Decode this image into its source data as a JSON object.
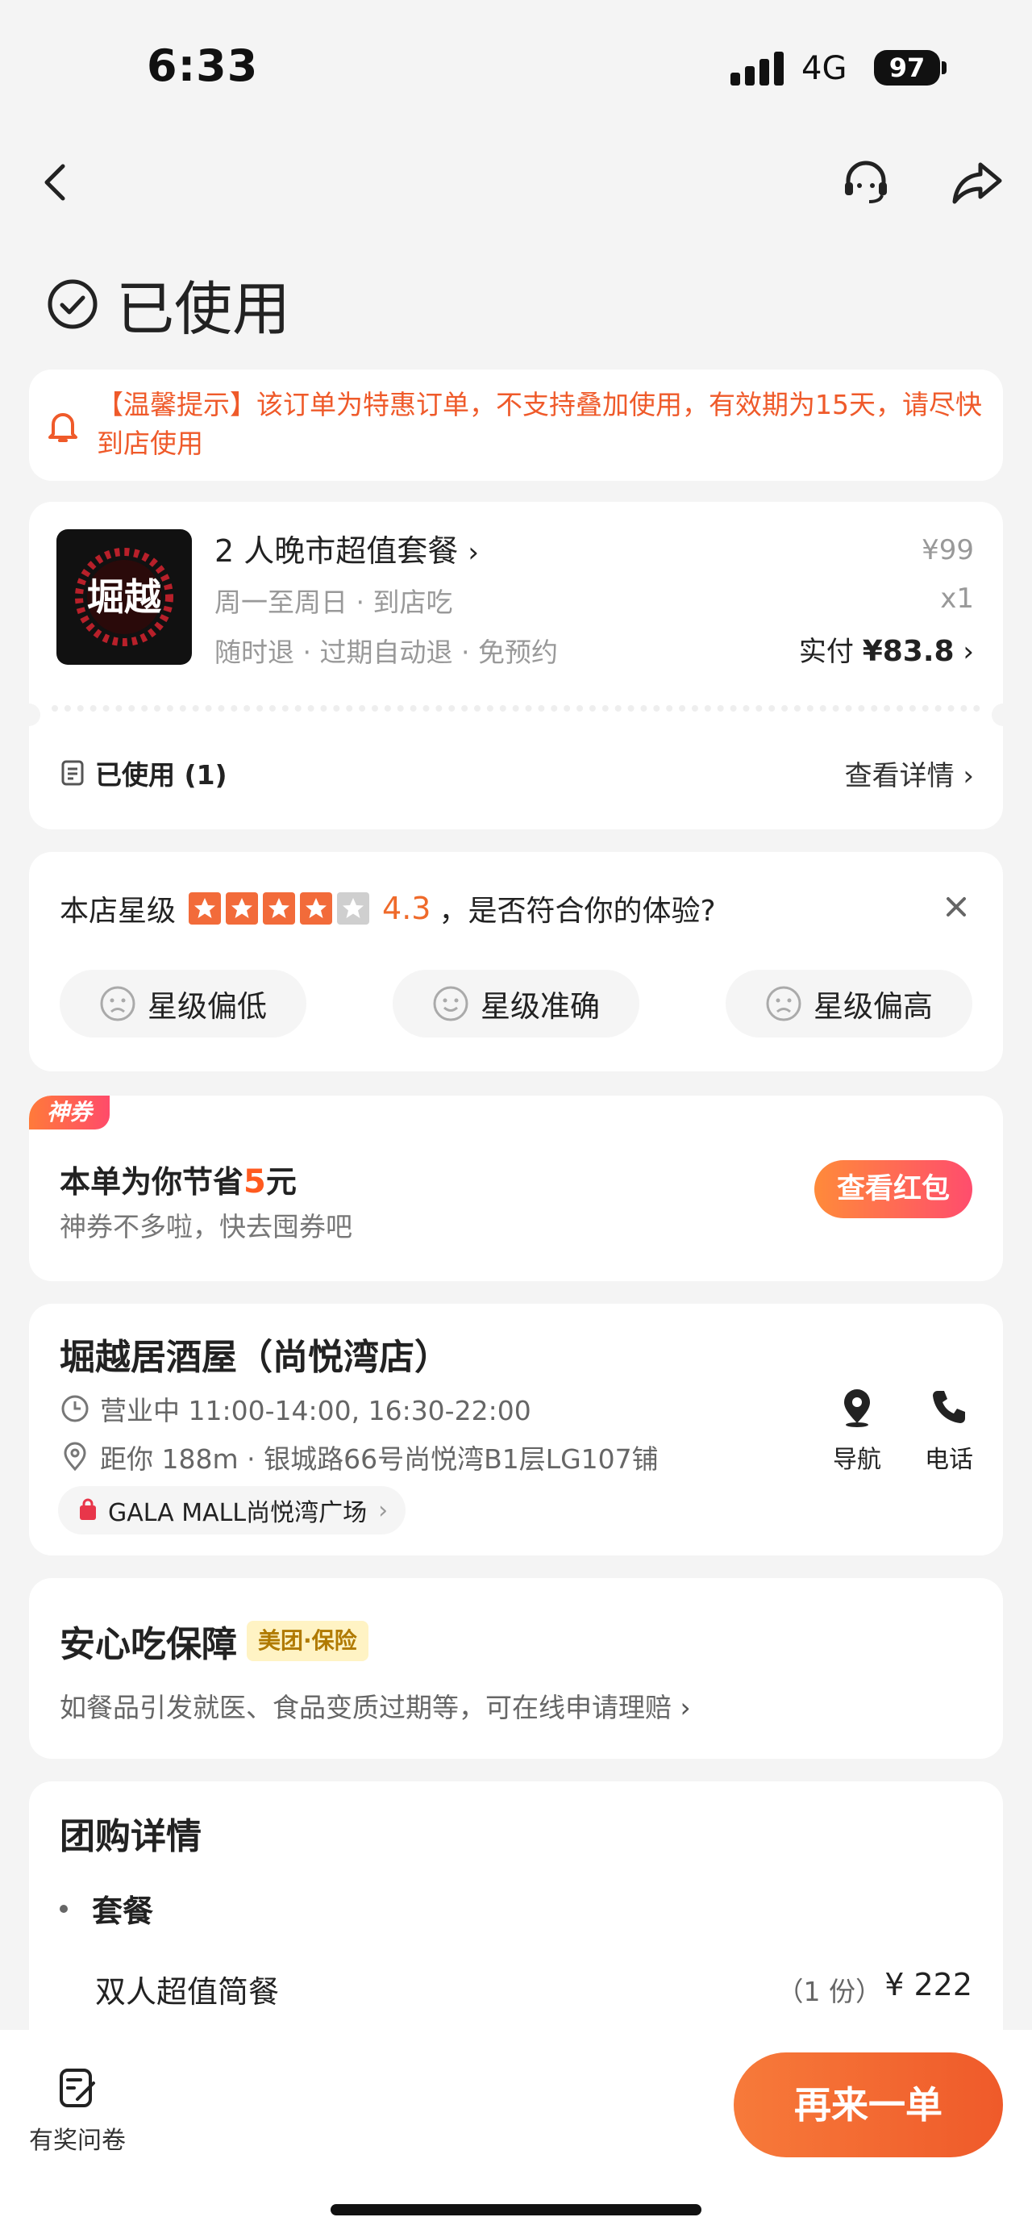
{
  "status_bar": {
    "time": "6:33",
    "network": "4G",
    "battery": "97"
  },
  "page": {
    "status_title": "已使用"
  },
  "notice": {
    "text": "【温馨提示】该订单为特惠订单，不支持叠加使用，有效期为15天，请尽快到店使用"
  },
  "order": {
    "title": "2 人晚市超值套餐",
    "subtitle": "周一至周日 · 到店吃",
    "tags": "随时退 · 过期自动退 · 免预约",
    "price": "¥99",
    "quantity": "x1",
    "paid_label": "实付",
    "paid_amount": "¥83.8",
    "used_label": "已使用 (1)",
    "detail_link": "查看详情",
    "logo_text": "堀越"
  },
  "rating": {
    "label": "本店星级",
    "score": "4.3",
    "question": "，是否符合你的体验?",
    "stars_filled": 4,
    "stars_total": 5,
    "options": [
      "星级偏低",
      "星级准确",
      "星级偏高"
    ]
  },
  "coupon": {
    "badge": "神券",
    "title_prefix": "本单为你节省",
    "amount": "5",
    "title_suffix": "元",
    "subtitle": "神券不多啦，快去囤券吧",
    "button": "查看红包"
  },
  "shop": {
    "name": "堀越居酒屋（尚悦湾店）",
    "hours": "营业中 11:00-14:00, 16:30-22:00",
    "distance": "距你 188m ·  银城路66号尚悦湾B1层LG107铺",
    "mall": "GALA MALL尚悦湾广场",
    "nav_label": "导航",
    "phone_label": "电话"
  },
  "guarantee": {
    "title": "安心吃保障",
    "badge": "美团·保险",
    "desc": "如餐品引发就医、食品变质过期等，可在线申请理赔"
  },
  "details": {
    "title": "团购详情",
    "section": "套餐",
    "item": "双人超值简餐",
    "item_qty": "（1 份）",
    "item_price": "¥ 222"
  },
  "bottom": {
    "survey_label": "有奖问卷",
    "reorder_label": "再来一单"
  },
  "colors": {
    "accent": "#ef5a2a",
    "star": "#f26b3a"
  }
}
